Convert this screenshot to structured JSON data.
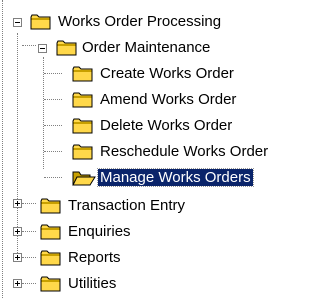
{
  "tree": {
    "root": {
      "label": "Works Order Processing",
      "expanded": true,
      "icon": "folder-closed-icon"
    },
    "order_maintenance": {
      "label": "Order Maintenance",
      "expanded": true,
      "icon": "folder-closed-icon"
    },
    "children": [
      {
        "label": "Create Works Order",
        "icon": "folder-closed-icon"
      },
      {
        "label": "Amend Works Order",
        "icon": "folder-closed-icon"
      },
      {
        "label": "Delete Works Order",
        "icon": "folder-closed-icon"
      },
      {
        "label": "Reschedule Works Order",
        "icon": "folder-closed-icon"
      },
      {
        "label": "Manage Works Orders",
        "icon": "folder-open-icon",
        "selected": true
      }
    ],
    "siblings": [
      {
        "label": "Transaction Entry",
        "expanded": false,
        "icon": "folder-closed-icon"
      },
      {
        "label": "Enquiries",
        "expanded": false,
        "icon": "folder-closed-icon"
      },
      {
        "label": "Reports",
        "expanded": false,
        "icon": "folder-closed-icon"
      },
      {
        "label": "Utilities",
        "expanded": false,
        "icon": "folder-closed-icon"
      }
    ]
  },
  "colors": {
    "selection_bg": "#0a246a",
    "folder_fill": "#ffd84a",
    "folder_shade": "#c8a000",
    "tree_lines": "#808080"
  }
}
